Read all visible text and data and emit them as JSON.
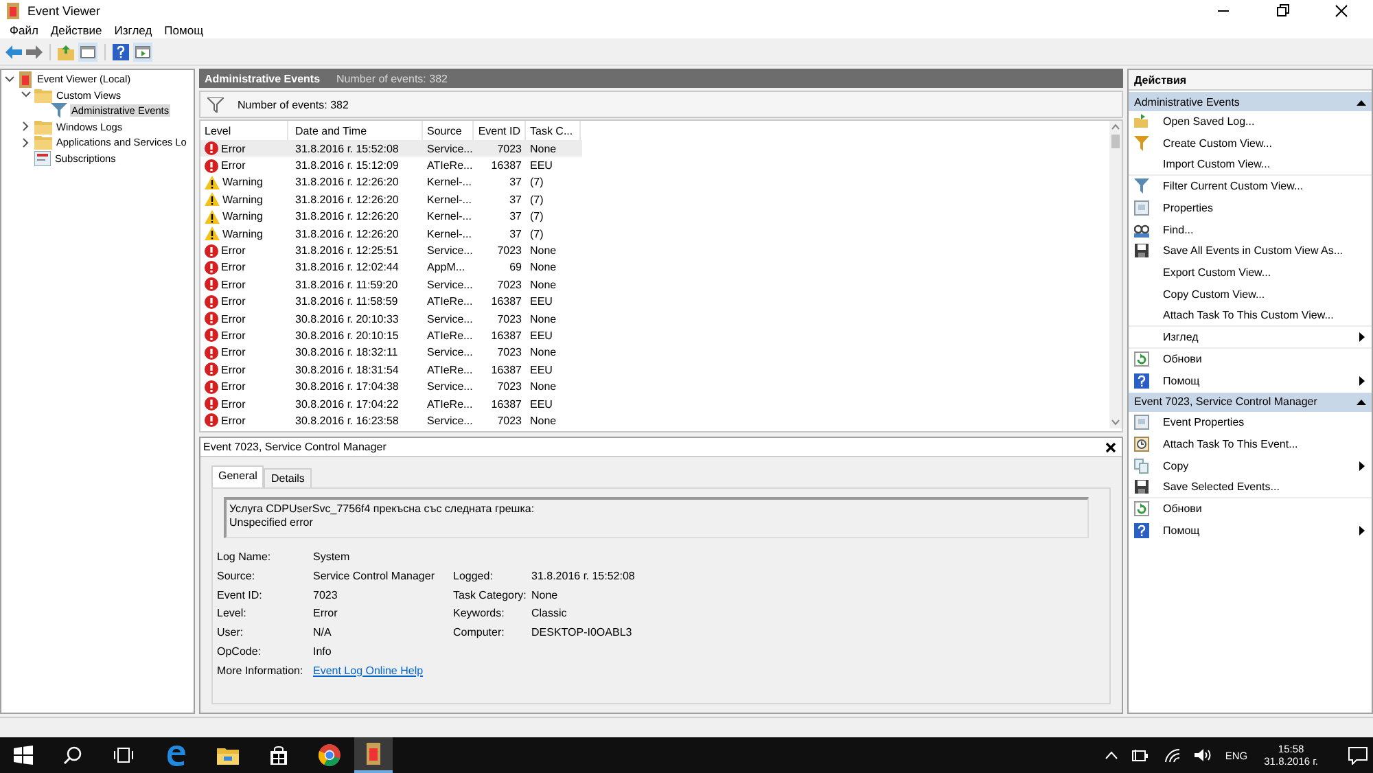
{
  "window": {
    "title": "Event Viewer"
  },
  "menu": [
    "Файл",
    "Действие",
    "Изглед",
    "Помощ"
  ],
  "tree": [
    {
      "label": "Event Viewer (Local)",
      "kind": "root",
      "expanded": true,
      "selected": false,
      "children": [
        {
          "label": "Custom Views",
          "kind": "folder",
          "expanded": true,
          "selected": false,
          "children": [
            {
              "label": "Administrative Events",
              "kind": "filter",
              "selected": true
            }
          ]
        },
        {
          "label": "Windows Logs",
          "kind": "folder",
          "expanded": false,
          "selected": false
        },
        {
          "label": "Applications and Services Lo",
          "kind": "folder",
          "expanded": false,
          "selected": false
        },
        {
          "label": "Subscriptions",
          "kind": "subs",
          "selected": false
        }
      ]
    }
  ],
  "center": {
    "title": "Administrative Events",
    "count": "Number of events: 382",
    "filter_text": "Number of events: 382",
    "columns": [
      "Level",
      "Date and Time",
      "Source",
      "Event ID",
      "Task C..."
    ],
    "rows": [
      {
        "kind": "error",
        "level": "Error",
        "date": "31.8.2016 г. 15:52:08",
        "source": "Service...",
        "id": "7023",
        "task": "None",
        "selected": true
      },
      {
        "kind": "error",
        "level": "Error",
        "date": "31.8.2016 г. 15:12:09",
        "source": "ATIeRe...",
        "id": "16387",
        "task": "EEU",
        "selected": false
      },
      {
        "kind": "warning",
        "level": "Warning",
        "date": "31.8.2016 г. 12:26:20",
        "source": "Kernel-...",
        "id": "37",
        "task": "(7)",
        "selected": false
      },
      {
        "kind": "warning",
        "level": "Warning",
        "date": "31.8.2016 г. 12:26:20",
        "source": "Kernel-...",
        "id": "37",
        "task": "(7)",
        "selected": false
      },
      {
        "kind": "warning",
        "level": "Warning",
        "date": "31.8.2016 г. 12:26:20",
        "source": "Kernel-...",
        "id": "37",
        "task": "(7)",
        "selected": false
      },
      {
        "kind": "warning",
        "level": "Warning",
        "date": "31.8.2016 г. 12:26:20",
        "source": "Kernel-...",
        "id": "37",
        "task": "(7)",
        "selected": false
      },
      {
        "kind": "error",
        "level": "Error",
        "date": "31.8.2016 г. 12:25:51",
        "source": "Service...",
        "id": "7023",
        "task": "None",
        "selected": false
      },
      {
        "kind": "error",
        "level": "Error",
        "date": "31.8.2016 г. 12:02:44",
        "source": "AppM...",
        "id": "69",
        "task": "None",
        "selected": false
      },
      {
        "kind": "error",
        "level": "Error",
        "date": "31.8.2016 г. 11:59:20",
        "source": "Service...",
        "id": "7023",
        "task": "None",
        "selected": false
      },
      {
        "kind": "error",
        "level": "Error",
        "date": "31.8.2016 г. 11:58:59",
        "source": "ATIeRe...",
        "id": "16387",
        "task": "EEU",
        "selected": false
      },
      {
        "kind": "error",
        "level": "Error",
        "date": "30.8.2016 г. 20:10:33",
        "source": "Service...",
        "id": "7023",
        "task": "None",
        "selected": false
      },
      {
        "kind": "error",
        "level": "Error",
        "date": "30.8.2016 г. 20:10:15",
        "source": "ATIeRe...",
        "id": "16387",
        "task": "EEU",
        "selected": false
      },
      {
        "kind": "error",
        "level": "Error",
        "date": "30.8.2016 г. 18:32:11",
        "source": "Service...",
        "id": "7023",
        "task": "None",
        "selected": false
      },
      {
        "kind": "error",
        "level": "Error",
        "date": "30.8.2016 г. 18:31:54",
        "source": "ATIeRe...",
        "id": "16387",
        "task": "EEU",
        "selected": false
      },
      {
        "kind": "error",
        "level": "Error",
        "date": "30.8.2016 г. 17:04:38",
        "source": "Service...",
        "id": "7023",
        "task": "None",
        "selected": false
      },
      {
        "kind": "error",
        "level": "Error",
        "date": "30.8.2016 г. 17:04:22",
        "source": "ATIeRe...",
        "id": "16387",
        "task": "EEU",
        "selected": false
      },
      {
        "kind": "error",
        "level": "Error",
        "date": "30.8.2016 г. 16:23:58",
        "source": "Service...",
        "id": "7023",
        "task": "None",
        "selected": false
      }
    ]
  },
  "detail": {
    "title": "Event 7023, Service Control Manager",
    "tabs": [
      {
        "label": "General",
        "selected": true
      },
      {
        "label": "Details",
        "selected": false
      }
    ],
    "message": [
      "Услуга CDPUserSvc_7756f4 прекъсна със следната грешка:",
      "Unspecified error"
    ],
    "fields": [
      {
        "label": "Log Name:",
        "value": "System"
      },
      {
        "label": "Source:",
        "value": "Service Control Manager",
        "label2": "Logged:",
        "value2": "31.8.2016 г. 15:52:08"
      },
      {
        "label": "Event ID:",
        "value": "7023",
        "label2": "Task Category:",
        "value2": "None"
      },
      {
        "label": "Level:",
        "value": "Error",
        "label2": "Keywords:",
        "value2": "Classic"
      },
      {
        "label": "User:",
        "value": "N/A",
        "label2": "Computer:",
        "value2": "DESKTOP-I0OABL3"
      },
      {
        "label": "OpCode:",
        "value": "Info"
      }
    ],
    "more_info_label": "More Information:",
    "more_info_link": "Event Log Online Help"
  },
  "actions": {
    "title": "Действия",
    "sections": [
      {
        "title": "Administrative Events",
        "expanded": true,
        "items": [
          {
            "label": "Open Saved Log...",
            "kind": "open"
          },
          {
            "label": "Create Custom View...",
            "kind": "filter-new"
          },
          {
            "label": "Import Custom View...",
            "kind": "none",
            "divider": true
          },
          {
            "label": "Filter Current Custom View...",
            "kind": "filter"
          },
          {
            "label": "Properties",
            "kind": "properties"
          },
          {
            "label": "Find...",
            "kind": "find"
          },
          {
            "label": "Save All Events in Custom View As...",
            "kind": "save"
          },
          {
            "label": "Export Custom View...",
            "kind": "none"
          },
          {
            "label": "Copy Custom View...",
            "kind": "none"
          },
          {
            "label": "Attach Task To This Custom View...",
            "kind": "none",
            "divider": true
          },
          {
            "label": "Изглед",
            "kind": "none",
            "submenu": true,
            "divider": true
          },
          {
            "label": "Обнови",
            "kind": "refresh"
          },
          {
            "label": "Помощ",
            "kind": "help",
            "submenu": true
          }
        ]
      },
      {
        "title": "Event 7023, Service Control Manager",
        "expanded": true,
        "items": [
          {
            "label": "Event Properties",
            "kind": "properties"
          },
          {
            "label": "Attach Task To This Event...",
            "kind": "task"
          },
          {
            "label": "Copy",
            "kind": "copy",
            "submenu": true
          },
          {
            "label": "Save Selected Events...",
            "kind": "save",
            "divider": true
          },
          {
            "label": "Обнови",
            "kind": "refresh"
          },
          {
            "label": "Помощ",
            "kind": "help",
            "submenu": true
          }
        ]
      }
    ]
  },
  "taskbar": {
    "language": "ENG",
    "time": "15:58",
    "date": "31.8.2016 г."
  }
}
